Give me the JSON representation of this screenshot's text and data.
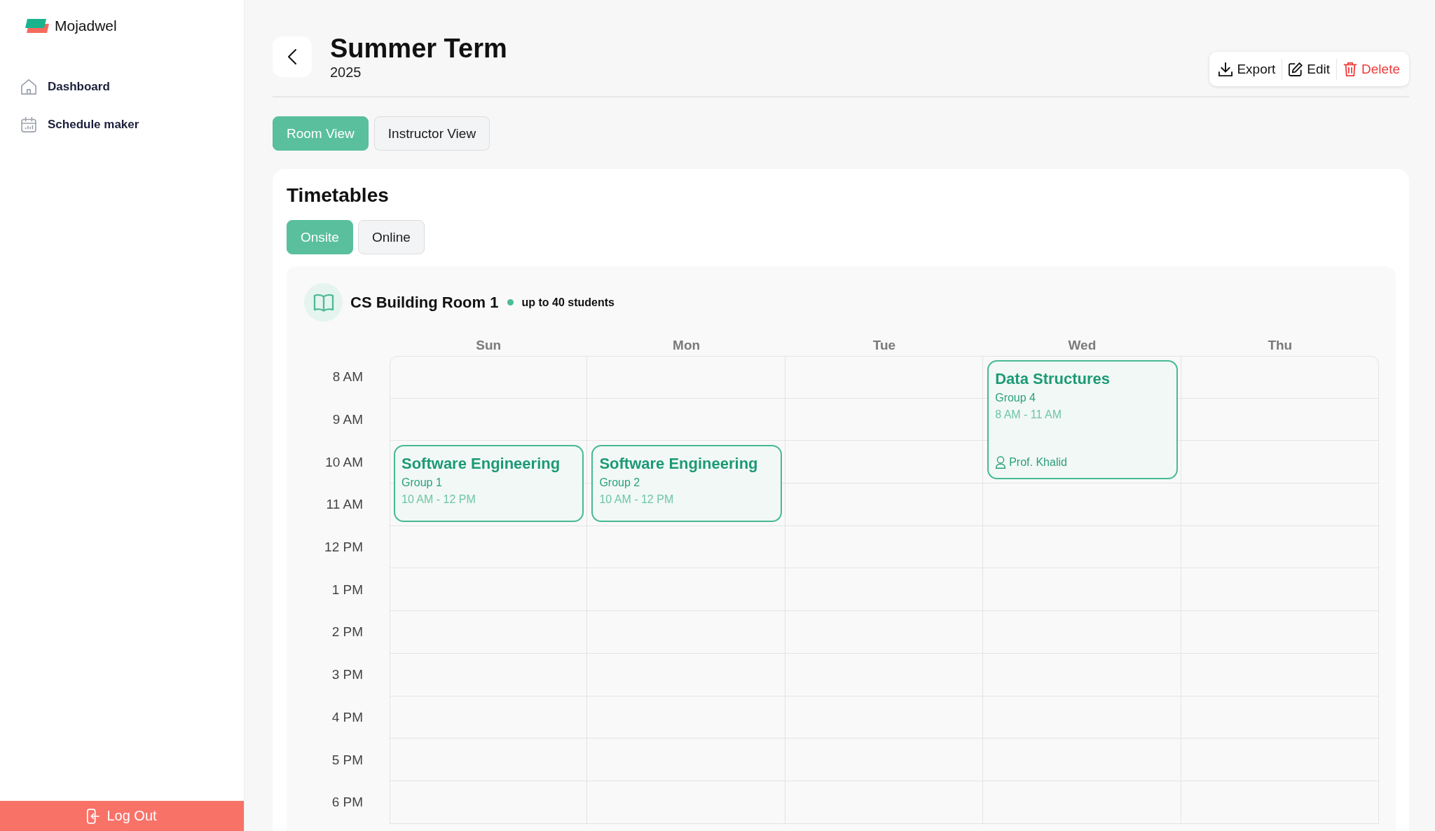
{
  "sidebar": {
    "brand": "Mojadwel",
    "items": [
      {
        "label": "Dashboard",
        "selected": false
      },
      {
        "label": "Schedule maker",
        "selected": false
      }
    ],
    "logout": "Log Out"
  },
  "header": {
    "title": "Summer Term",
    "subtitle": "2025",
    "actions": [
      {
        "kind": "export",
        "label": "Export"
      },
      {
        "kind": "edit",
        "label": "Edit"
      },
      {
        "kind": "delete",
        "label": "Delete"
      }
    ]
  },
  "view_tabs": [
    {
      "label": "Room View",
      "selected": true
    },
    {
      "label": "Instructor View",
      "selected": false
    }
  ],
  "timetables": {
    "title": "Timetables",
    "mode_tabs": [
      {
        "label": "Onsite",
        "selected": true
      },
      {
        "label": "Online",
        "selected": false
      }
    ],
    "room": {
      "name": "CS Building Room 1",
      "capacity": "up to 40 students"
    },
    "days": [
      "Sun",
      "Mon",
      "Tue",
      "Wed",
      "Thu"
    ],
    "rows": [
      {
        "time": "8 AM",
        "cells": [
          {
            "kind": "slot"
          },
          {
            "kind": "slot"
          },
          {
            "kind": "slot"
          },
          {
            "kind": "class",
            "title": "Data Structures",
            "group": "Group 4",
            "time": "8 AM - 11 AM",
            "instructor": "Prof. Khalid"
          },
          {
            "kind": "slot"
          }
        ]
      },
      {
        "time": "9 AM",
        "cells": [
          {
            "kind": "slot"
          },
          {
            "kind": "slot"
          },
          {
            "kind": "slot"
          },
          {
            "kind": "continued"
          },
          {
            "kind": "slot"
          }
        ]
      },
      {
        "time": "10 AM",
        "cells": [
          {
            "kind": "class",
            "title": "Software Engineering",
            "group": "Group 1",
            "time": "10 AM - 12 PM"
          },
          {
            "kind": "class",
            "title": "Software Engineering",
            "group": "Group 2",
            "time": "10 AM - 12 PM"
          },
          {
            "kind": "slot"
          },
          {
            "kind": "continued"
          },
          {
            "kind": "slot"
          }
        ]
      },
      {
        "time": "11 AM",
        "cells": [
          {
            "kind": "continued"
          },
          {
            "kind": "continued"
          },
          {
            "kind": "slot"
          },
          {
            "kind": "slot"
          },
          {
            "kind": "slot"
          }
        ]
      },
      {
        "time": "12 PM",
        "cells": [
          {
            "kind": "slot"
          },
          {
            "kind": "slot"
          },
          {
            "kind": "slot"
          },
          {
            "kind": "slot"
          },
          {
            "kind": "slot"
          }
        ]
      },
      {
        "time": "1 PM",
        "cells": [
          {
            "kind": "slot"
          },
          {
            "kind": "slot"
          },
          {
            "kind": "slot"
          },
          {
            "kind": "slot"
          },
          {
            "kind": "slot"
          }
        ]
      },
      {
        "time": "2 PM",
        "cells": [
          {
            "kind": "slot"
          },
          {
            "kind": "slot"
          },
          {
            "kind": "slot"
          },
          {
            "kind": "slot"
          },
          {
            "kind": "slot"
          }
        ]
      },
      {
        "time": "3 PM",
        "cells": [
          {
            "kind": "slot"
          },
          {
            "kind": "slot"
          },
          {
            "kind": "slot"
          },
          {
            "kind": "slot"
          },
          {
            "kind": "slot"
          }
        ]
      },
      {
        "time": "4 PM",
        "cells": [
          {
            "kind": "slot"
          },
          {
            "kind": "slot"
          },
          {
            "kind": "slot"
          },
          {
            "kind": "slot"
          },
          {
            "kind": "slot"
          }
        ]
      },
      {
        "time": "5 PM",
        "cells": [
          {
            "kind": "slot"
          },
          {
            "kind": "slot"
          },
          {
            "kind": "slot"
          },
          {
            "kind": "slot"
          },
          {
            "kind": "slot"
          }
        ]
      },
      {
        "time": "6 PM",
        "cells": [
          {
            "kind": "slot"
          },
          {
            "kind": "slot"
          },
          {
            "kind": "slot"
          },
          {
            "kind": "slot"
          },
          {
            "kind": "slot"
          }
        ]
      }
    ]
  }
}
